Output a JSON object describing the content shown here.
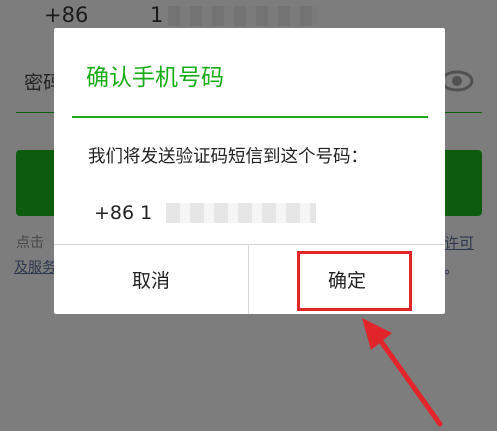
{
  "background_form": {
    "country_code": "+86",
    "phone_prefix": "1",
    "password_label": "密码",
    "agreement_text_1": "点击",
    "agreement_text_2": "及服务",
    "agreement_link_right_1": "许可",
    "agreement_link_right_2": "。"
  },
  "dialog": {
    "title": "确认手机号码",
    "message": "我们将发送验证码短信到这个号码：",
    "phone": "+86 1",
    "cancel_label": "取消",
    "confirm_label": "确定"
  },
  "colors": {
    "accent": "#1aad19",
    "highlight": "#e2252b"
  }
}
